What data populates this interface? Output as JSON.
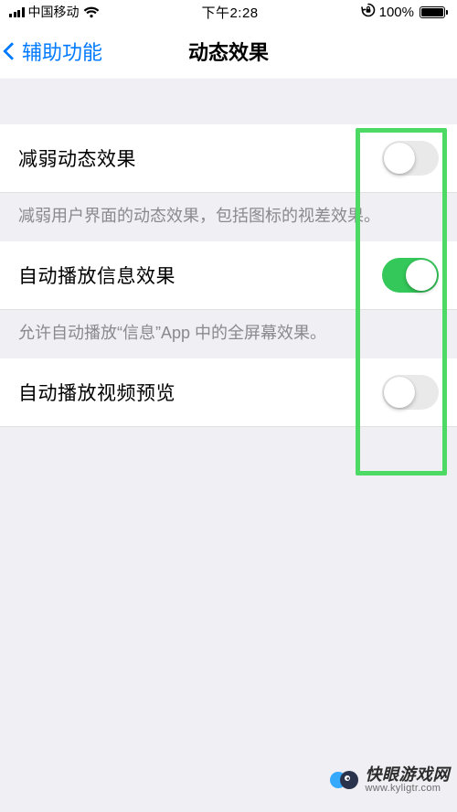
{
  "status_bar": {
    "carrier": "中国移动",
    "time": "下午2:28",
    "battery_percent": "100%"
  },
  "nav": {
    "back_label": "辅助功能",
    "title": "动态效果"
  },
  "rows": {
    "reduce_motion": {
      "label": "减弱动态效果",
      "footer": "减弱用户界面的动态效果，包括图标的视差效果。",
      "value": false
    },
    "autoplay_messages": {
      "label": "自动播放信息效果",
      "footer": "允许自动播放“信息”App 中的全屏幕效果。",
      "value": true
    },
    "autoplay_video": {
      "label": "自动播放视频预览",
      "value": false
    }
  },
  "watermark": {
    "title": "快眼游戏网",
    "url": "www.kyligtr.com"
  },
  "colors": {
    "tint": "#007aff",
    "switch_on": "#34c759",
    "highlight": "#4cd964"
  }
}
